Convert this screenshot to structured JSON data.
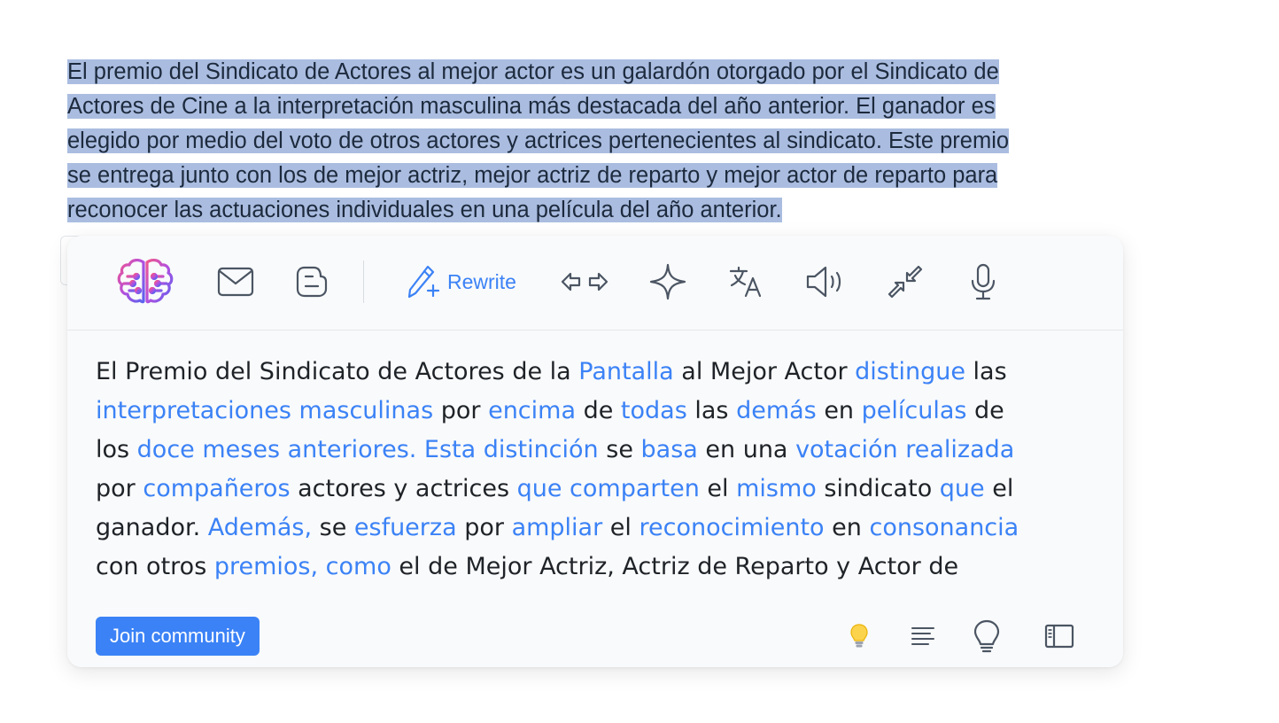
{
  "selected_text": {
    "lines": [
      "El premio del Sindicato de Actores al mejor actor es un galardón otorgado por el Sindicato de",
      "Actores de Cine a la interpretación masculina más destacada del año anterior. El ganador es",
      "elegido por medio del voto de otros actores y actrices pertenecientes al sindicato. Este premio",
      "se entrega junto con los de mejor actriz, mejor actriz de reparto y mejor actor de reparto para",
      "reconocer las actuaciones individuales en una película del año anterior. "
    ]
  },
  "toolbar": {
    "logo_icon": "brain-logo-icon",
    "items": [
      {
        "icon": "mail-icon"
      },
      {
        "icon": "blogger-icon"
      },
      {
        "icon": "magic-pen-icon",
        "label": "Rewrite"
      },
      {
        "icon": "arrows-left-right-icon"
      },
      {
        "icon": "sparkle-icon"
      },
      {
        "icon": "translate-icon"
      },
      {
        "icon": "speaker-icon"
      },
      {
        "icon": "shrink-arrows-icon"
      },
      {
        "icon": "microphone-icon"
      }
    ],
    "rewrite_label": "Rewrite"
  },
  "result": {
    "segments": [
      {
        "t": "El Premio del Sindicato de Actores de la ",
        "h": false
      },
      {
        "t": "Pantalla",
        "h": true
      },
      {
        "t": " al Mejor Actor ",
        "h": false
      },
      {
        "t": "distingue",
        "h": true
      },
      {
        "t": " las ",
        "h": false
      },
      {
        "t": "interpretaciones masculinas",
        "h": true
      },
      {
        "t": " por ",
        "h": false
      },
      {
        "t": "encima",
        "h": true
      },
      {
        "t": " de ",
        "h": false
      },
      {
        "t": "todas",
        "h": true
      },
      {
        "t": " las ",
        "h": false
      },
      {
        "t": "demás",
        "h": true
      },
      {
        "t": " en ",
        "h": false
      },
      {
        "t": "películas",
        "h": true
      },
      {
        "t": " de los ",
        "h": false
      },
      {
        "t": "doce meses anteriores. Esta distinción",
        "h": true
      },
      {
        "t": " se ",
        "h": false
      },
      {
        "t": "basa",
        "h": true
      },
      {
        "t": " en una ",
        "h": false
      },
      {
        "t": "votación realizada",
        "h": true
      },
      {
        "t": " por ",
        "h": false
      },
      {
        "t": "compañeros",
        "h": true
      },
      {
        "t": " actores y actrices ",
        "h": false
      },
      {
        "t": "que comparten",
        "h": true
      },
      {
        "t": " el ",
        "h": false
      },
      {
        "t": "mismo",
        "h": true
      },
      {
        "t": " sindicato ",
        "h": false
      },
      {
        "t": "que",
        "h": true
      },
      {
        "t": " el ganador. ",
        "h": false
      },
      {
        "t": "Además,",
        "h": true
      },
      {
        "t": " se ",
        "h": false
      },
      {
        "t": "esfuerza",
        "h": true
      },
      {
        "t": " por ",
        "h": false
      },
      {
        "t": "ampliar",
        "h": true
      },
      {
        "t": " el ",
        "h": false
      },
      {
        "t": "reconocimiento",
        "h": true
      },
      {
        "t": " en ",
        "h": false
      },
      {
        "t": "consonancia",
        "h": true
      },
      {
        "t": " con otros ",
        "h": false
      },
      {
        "t": "premios, como",
        "h": true
      },
      {
        "t": " el de Mejor Actriz, Actriz de Reparto y Actor de",
        "h": false
      }
    ],
    "highlight_color": "#3b82f6"
  },
  "footer": {
    "join_label": "Join community",
    "icons": [
      "lightbulb-emoji-icon",
      "align-text-icon",
      "idea-bulb-icon",
      "sidebar-panel-icon"
    ]
  },
  "colors": {
    "accent": "#3b82f6",
    "selection": "#aabde0",
    "panel_bg": "#f9fafb"
  }
}
